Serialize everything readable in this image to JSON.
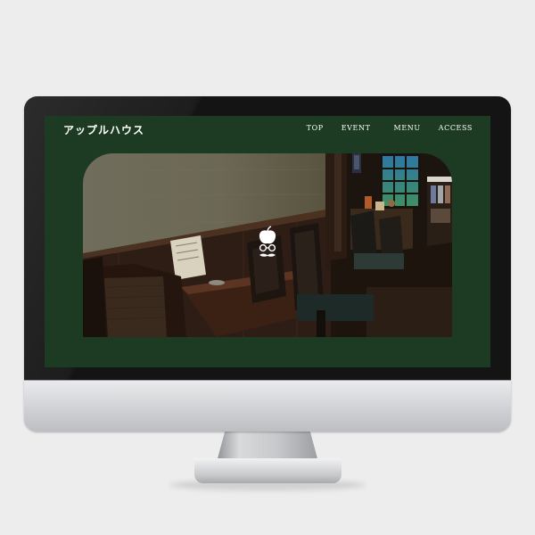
{
  "site": {
    "logo": "アップルハウス",
    "nav": [
      {
        "label": "TOP"
      },
      {
        "label": "EVENT"
      },
      {
        "label": "MENU"
      },
      {
        "label": "ACCESS"
      }
    ],
    "hero": {
      "image": "cafe-interior-photo",
      "emblem_icon": "apple-glasses-mustache-icon"
    }
  },
  "colors": {
    "site_background": "#1d3b23",
    "text": "#ffffff",
    "page_background": "#ededed",
    "bezel": "#141414",
    "chin": "#d8d9dc"
  }
}
